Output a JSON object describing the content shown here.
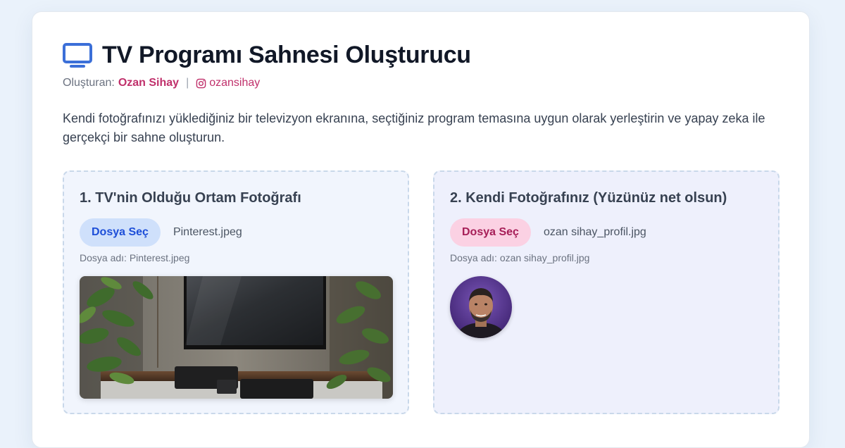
{
  "app": {
    "title": "TV Programı Sahnesi Oluşturucu",
    "title_icon": "tv-icon",
    "byline_label": "Oluşturan:",
    "author": "Ozan Sihay",
    "separator": "|",
    "instagram_icon": "instagram-icon",
    "instagram_handle": "ozansihay",
    "description": "Kendi fotoğrafınızı yüklediğiniz bir televizyon ekranına, seçtiğiniz program temasına uygun olarak yerleştirin ve yapay zeka ile gerçekçi bir sahne oluşturun."
  },
  "colors": {
    "accent_blue": "#1d4ed8",
    "accent_pink": "#c0306b",
    "icon_blue": "#3b6fd8"
  },
  "panels": [
    {
      "title": "1. TV'nin Olduğu Ortam Fotoğrafı",
      "button_label": "Dosya Seç",
      "selected_file": "Pinterest.jpeg",
      "file_meta": "Dosya adı: Pinterest.jpeg"
    },
    {
      "title": "2. Kendi Fotoğrafınız (Yüzünüz net olsun)",
      "button_label": "Dosya Seç",
      "selected_file": "ozan sihay_profil.jpg",
      "file_meta": "Dosya adı: ozan sihay_profil.jpg"
    }
  ]
}
